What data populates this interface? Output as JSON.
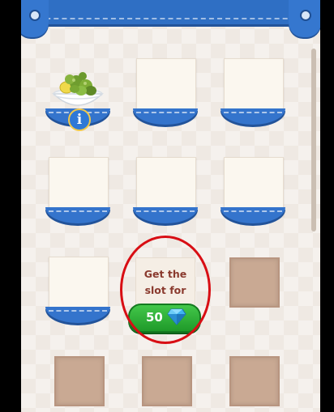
{
  "purchase_slot": {
    "line1": "Get the",
    "line2": "slot for",
    "price": "50",
    "currency_icon": "gem-icon"
  },
  "inventory": {
    "item_name_icon": "olive-bowl-icon",
    "info_label": "i"
  },
  "colors": {
    "banner_blue": "#2f6fc4",
    "price_green": "#2aa835",
    "highlight_red": "#d80e14",
    "locked_slot": "#c9a993"
  }
}
